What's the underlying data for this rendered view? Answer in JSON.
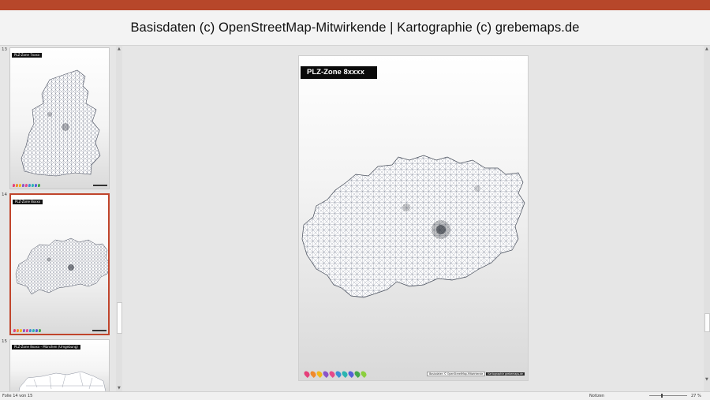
{
  "caption": "Basisdaten (c) OpenStreetMap-Mitwirkende | Kartographie (c) grebemaps.de",
  "thumbnails": [
    {
      "number": "13",
      "label": "PLZ-Zone 7xxxx"
    },
    {
      "number": "14",
      "label": "PLZ-Zone 8xxxx"
    },
    {
      "number": "15",
      "label": "PLZ-Zone 8xxxx - München (Umgebung)"
    }
  ],
  "slide": {
    "label": "PLZ-Zone 8xxxx",
    "credit_osm": "Basisdaten © OpenStreetMap-Mitwirkende",
    "credit_grebemaps": "Kartographie grebemaps.de",
    "pin_colors": [
      "#e5407a",
      "#f08a2c",
      "#f1b81a",
      "#8a54c8",
      "#e54a8a",
      "#3a8fd6",
      "#2bb5b0",
      "#5560d8",
      "#43a84a",
      "#8ccf3e"
    ]
  },
  "status": {
    "slide_info": "Folie 14 von 15",
    "notes": "Notizen",
    "zoom": "27 %"
  }
}
